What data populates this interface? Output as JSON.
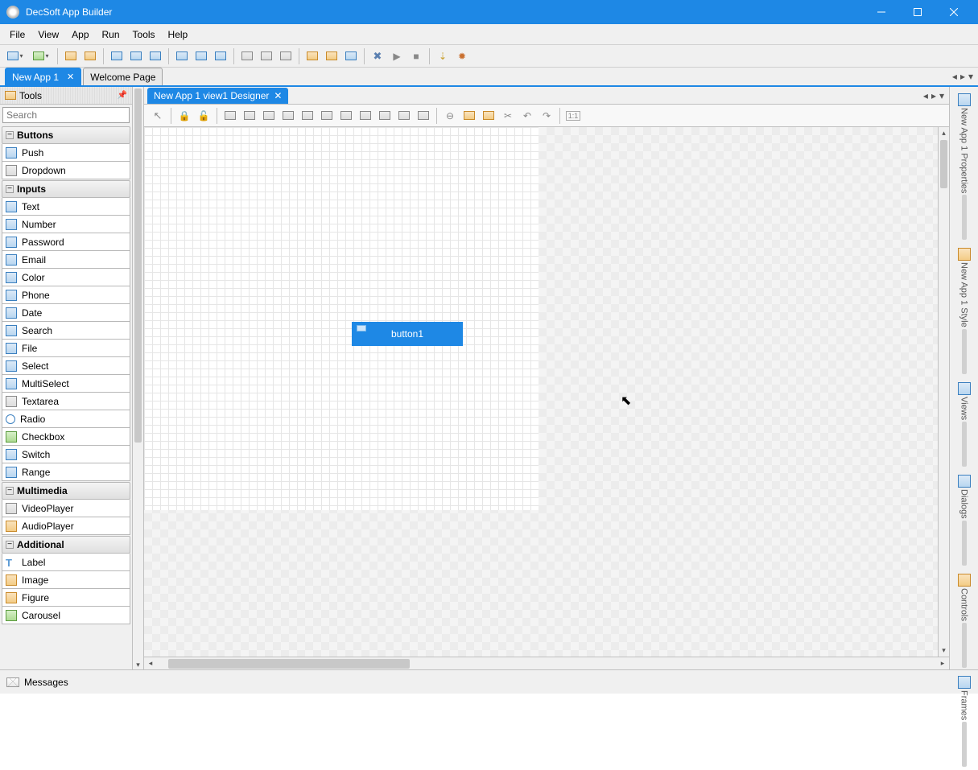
{
  "window": {
    "title": "DecSoft App Builder"
  },
  "menu": [
    "File",
    "View",
    "App",
    "Run",
    "Tools",
    "Help"
  ],
  "docTabs": [
    {
      "label": "New App 1",
      "active": true,
      "closable": true
    },
    {
      "label": "Welcome Page",
      "active": false,
      "closable": false
    }
  ],
  "toolsPanel": {
    "title": "Tools",
    "searchPlaceholder": "Search",
    "groups": [
      {
        "name": "Buttons",
        "items": [
          "Push",
          "Dropdown"
        ]
      },
      {
        "name": "Inputs",
        "items": [
          "Text",
          "Number",
          "Password",
          "Email",
          "Color",
          "Phone",
          "Date",
          "Search",
          "File",
          "Select",
          "MultiSelect",
          "Textarea",
          "Radio",
          "Checkbox",
          "Switch",
          "Range"
        ]
      },
      {
        "name": "Multimedia",
        "items": [
          "VideoPlayer",
          "AudioPlayer"
        ]
      },
      {
        "name": "Additional",
        "items": [
          "Label",
          "Image",
          "Figure",
          "Carousel"
        ]
      }
    ]
  },
  "designer": {
    "tabLabel": "New App 1 view1 Designer",
    "placedControl": "button1"
  },
  "rightTabs": [
    "New App 1 Properties",
    "New App 1 Style",
    "Views",
    "Dialogs",
    "Controls",
    "Frames"
  ],
  "status": {
    "messages": "Messages"
  }
}
